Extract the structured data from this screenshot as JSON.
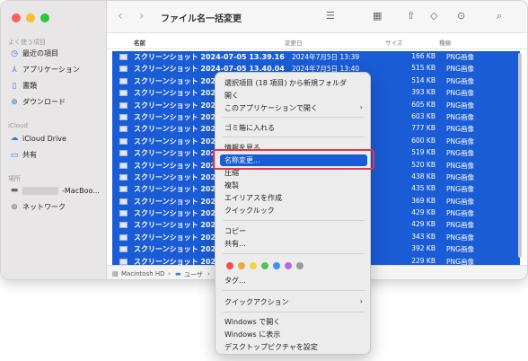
{
  "window": {
    "title": "ファイル名一括変更"
  },
  "sidebar": {
    "sections": [
      "よく使う項目",
      "iCloud",
      "場所"
    ],
    "favorites": [
      {
        "label": "最近の項目",
        "icon": "clock-icon"
      },
      {
        "label": "アプリケーション",
        "icon": "app-icon"
      },
      {
        "label": "書類",
        "icon": "document-icon"
      },
      {
        "label": "ダウンロード",
        "icon": "download-icon"
      }
    ],
    "icloud": [
      {
        "label": "iCloud Drive",
        "icon": "cloud-icon"
      },
      {
        "label": "共有",
        "icon": "folder-share-icon"
      }
    ],
    "locations": [
      {
        "label": "-MacBoo...",
        "icon": "laptop-icon"
      },
      {
        "label": "ネットワーク",
        "icon": "globe-icon"
      }
    ]
  },
  "columns": {
    "name": "名前",
    "date": "変更日",
    "size": "サイズ",
    "kind": "種類"
  },
  "files": [
    {
      "name": "スクリーンショット 2024-07-05 13.39.16",
      "date": "2024年7月5日 13:39",
      "size": "166 KB",
      "kind": "PNG画像"
    },
    {
      "name": "スクリーンショット 2024-07-05 13.40.04",
      "date": "2024年7月5日 13:40",
      "size": "515 KB",
      "kind": "PNG画像"
    },
    {
      "name": "スクリーンショット 2024",
      "date": "",
      "size": "514 KB",
      "kind": "PNG画像"
    },
    {
      "name": "スクリーンショット 2024",
      "date": "",
      "size": "393 KB",
      "kind": "PNG画像"
    },
    {
      "name": "スクリーンショット 2024",
      "date": "",
      "size": "605 KB",
      "kind": "PNG画像"
    },
    {
      "name": "スクリーンショット 2024",
      "date": "",
      "size": "603 KB",
      "kind": "PNG画像"
    },
    {
      "name": "スクリーンショット 2024",
      "date": "",
      "size": "777 KB",
      "kind": "PNG画像"
    },
    {
      "name": "スクリーンショット 2024",
      "date": "",
      "size": "600 KB",
      "kind": "PNG画像"
    },
    {
      "name": "スクリーンショット 2024",
      "date": "",
      "size": "519 KB",
      "kind": "PNG画像"
    },
    {
      "name": "スクリーンショット 2024",
      "date": "",
      "size": "520 KB",
      "kind": "PNG画像"
    },
    {
      "name": "スクリーンショット 2024",
      "date": "",
      "size": "438 KB",
      "kind": "PNG画像"
    },
    {
      "name": "スクリーンショット 2024",
      "date": "",
      "size": "435 KB",
      "kind": "PNG画像"
    },
    {
      "name": "スクリーンショット 2024",
      "date": "",
      "size": "369 KB",
      "kind": "PNG画像"
    },
    {
      "name": "スクリーンショット 2024",
      "date": "",
      "size": "429 KB",
      "kind": "PNG画像"
    },
    {
      "name": "スクリーンショット 2024",
      "date": "",
      "size": "429 KB",
      "kind": "PNG画像"
    },
    {
      "name": "スクリーンショット 2024",
      "date": "",
      "size": "343 KB",
      "kind": "PNG画像"
    },
    {
      "name": "スクリーンショット 2024",
      "date": "",
      "size": "392 KB",
      "kind": "PNG画像"
    },
    {
      "name": "スクリーンショット 2024",
      "date": "",
      "size": "229 KB",
      "kind": "PNG画像"
    }
  ],
  "pathbar": {
    "disk": "Macintosh HD",
    "sep": "›",
    "users": "ユーザ",
    "tail": "›"
  },
  "context_menu": {
    "new_folder": "選択項目 (18 項目) から新規フォルダ",
    "open": "開く",
    "open_with": "このアプリケーションで開く",
    "trash": "ゴミ箱に入れる",
    "get_info": "情報を見る",
    "rename": "名称変更...",
    "compress": "圧縮",
    "duplicate": "複製",
    "alias": "エイリアスを作成",
    "quicklook": "クイックルック",
    "copy": "コピー",
    "share": "共有...",
    "tags": "タグ...",
    "quick_actions": "クイックアクション",
    "open_windows": "Windows で開く",
    "show_windows": "Windows に表示",
    "desktop_picture": "デスクトップピクチャを設定",
    "tag_colors": [
      "#f05049",
      "#f7a43a",
      "#f5d33a",
      "#5ac150",
      "#3c8ff7",
      "#b46be0",
      "#999999"
    ]
  },
  "colors": {
    "selection": "#1a5cd6",
    "highlight_box": "#e8344a"
  }
}
